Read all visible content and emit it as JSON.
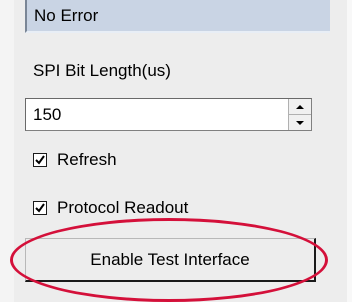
{
  "status": {
    "text": "No Error"
  },
  "spi": {
    "label": "SPI Bit Length(us)",
    "value": "150"
  },
  "options": {
    "refresh": {
      "label": "Refresh",
      "checked": true
    },
    "protocol_readout": {
      "label": "Protocol Readout",
      "checked": true
    }
  },
  "actions": {
    "enable_test_label": "Enable Test Interface"
  },
  "colors": {
    "highlight": "#d4103a",
    "status_bg": "#c9d4e4",
    "panel_bg": "#ededed"
  }
}
